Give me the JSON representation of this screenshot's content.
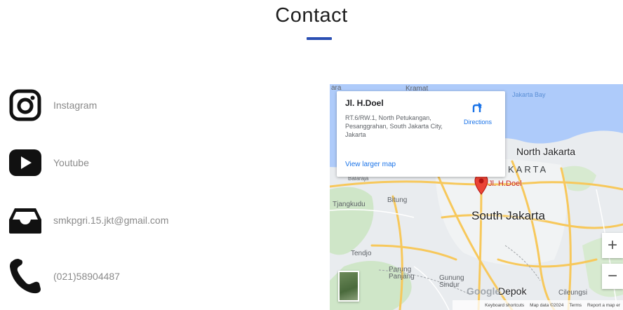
{
  "header": {
    "title": "Contact",
    "accent_color": "#2b4fb3"
  },
  "contacts": [
    {
      "icon": "instagram-icon",
      "label": "Instagram"
    },
    {
      "icon": "youtube-icon",
      "label": "Youtube"
    },
    {
      "icon": "inbox-icon",
      "label": "smkpgri.15.jkt@gmail.com"
    },
    {
      "icon": "phone-icon",
      "label": "(021)58904487"
    }
  ],
  "map": {
    "card": {
      "name": "Jl. H.Doel",
      "address": "RT.6/RW.1, North Petukangan, Pesanggrahan, South Jakarta City, Jakarta",
      "directions": "Directions",
      "larger_map": "View larger map"
    },
    "labels": {
      "north_jakarta": "North Jakarta",
      "jakarta_partial": "KARTA",
      "pin_label": "Jl. H.Doel",
      "south_jakarta": "South Jakarta",
      "tangerang_partial": "ara",
      "kramat": "Kramat",
      "jakarta_bay": "Jakarta Bay",
      "tangkudu": "Tjangkudu",
      "bitung": "Bitung",
      "balaraja": "Balaraja",
      "tendjo": "Tendjo",
      "parung_panjang": "Parung Panjang",
      "gunung_sindur": "Gunung Sindur",
      "depok": "Depok",
      "cileungsi": "Cileungsi",
      "google": "Google"
    },
    "zoom_in": "+",
    "zoom_out": "−",
    "footer": {
      "shortcuts": "Keyboard shortcuts",
      "map_data": "Map data ©2024",
      "terms": "Terms",
      "report": "Report a map er"
    }
  }
}
